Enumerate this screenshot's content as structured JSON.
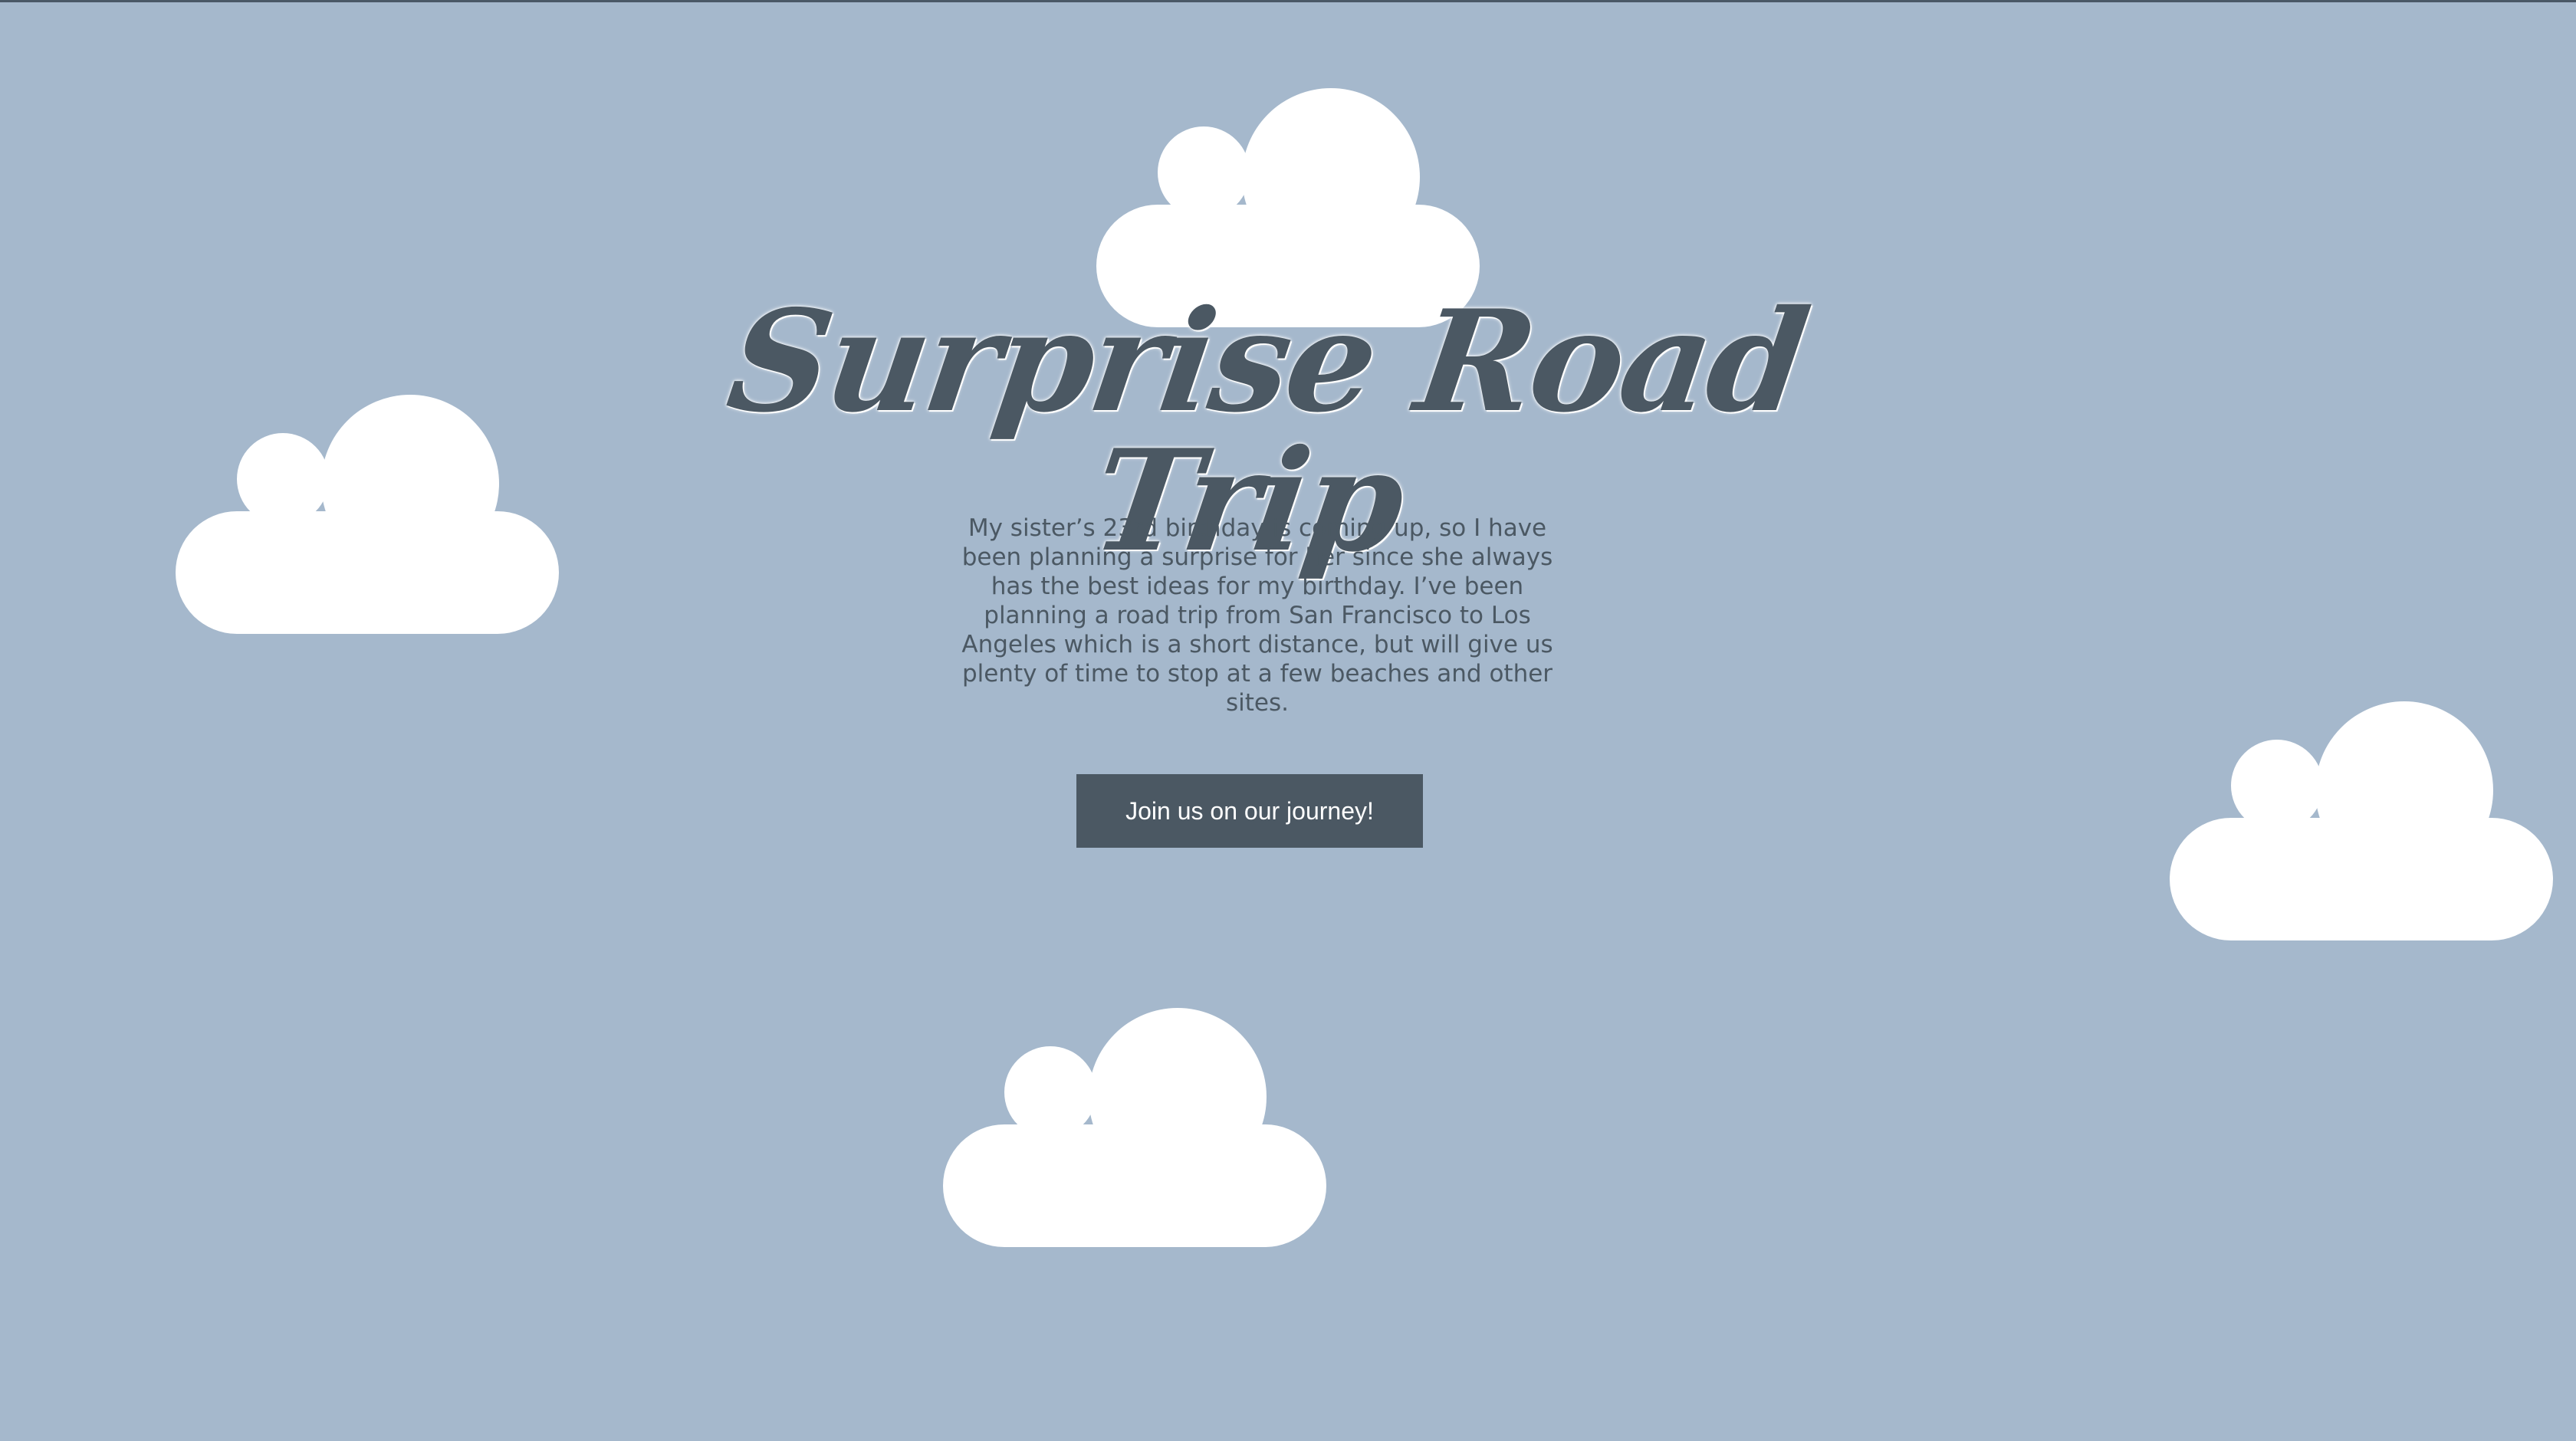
{
  "hero": {
    "title": "Surprise Road Trip",
    "description": "My sister’s 23rd birthday is coming up, so I have been planning a surprise for her since she always has the best ideas for my birthday. I’ve been planning a road trip from San Francisco to Los Angeles which is a short distance, but will give us plenty of time to stop at a few beaches and other sites.",
    "cta_label": "Join us on our journey!"
  },
  "colors": {
    "background": "#a5b8cc",
    "text": "#4b5863",
    "button": "#4b5863",
    "cloud": "#ffffff"
  },
  "icons": [
    "cloud-icon",
    "cloud-icon",
    "cloud-icon",
    "cloud-icon"
  ]
}
